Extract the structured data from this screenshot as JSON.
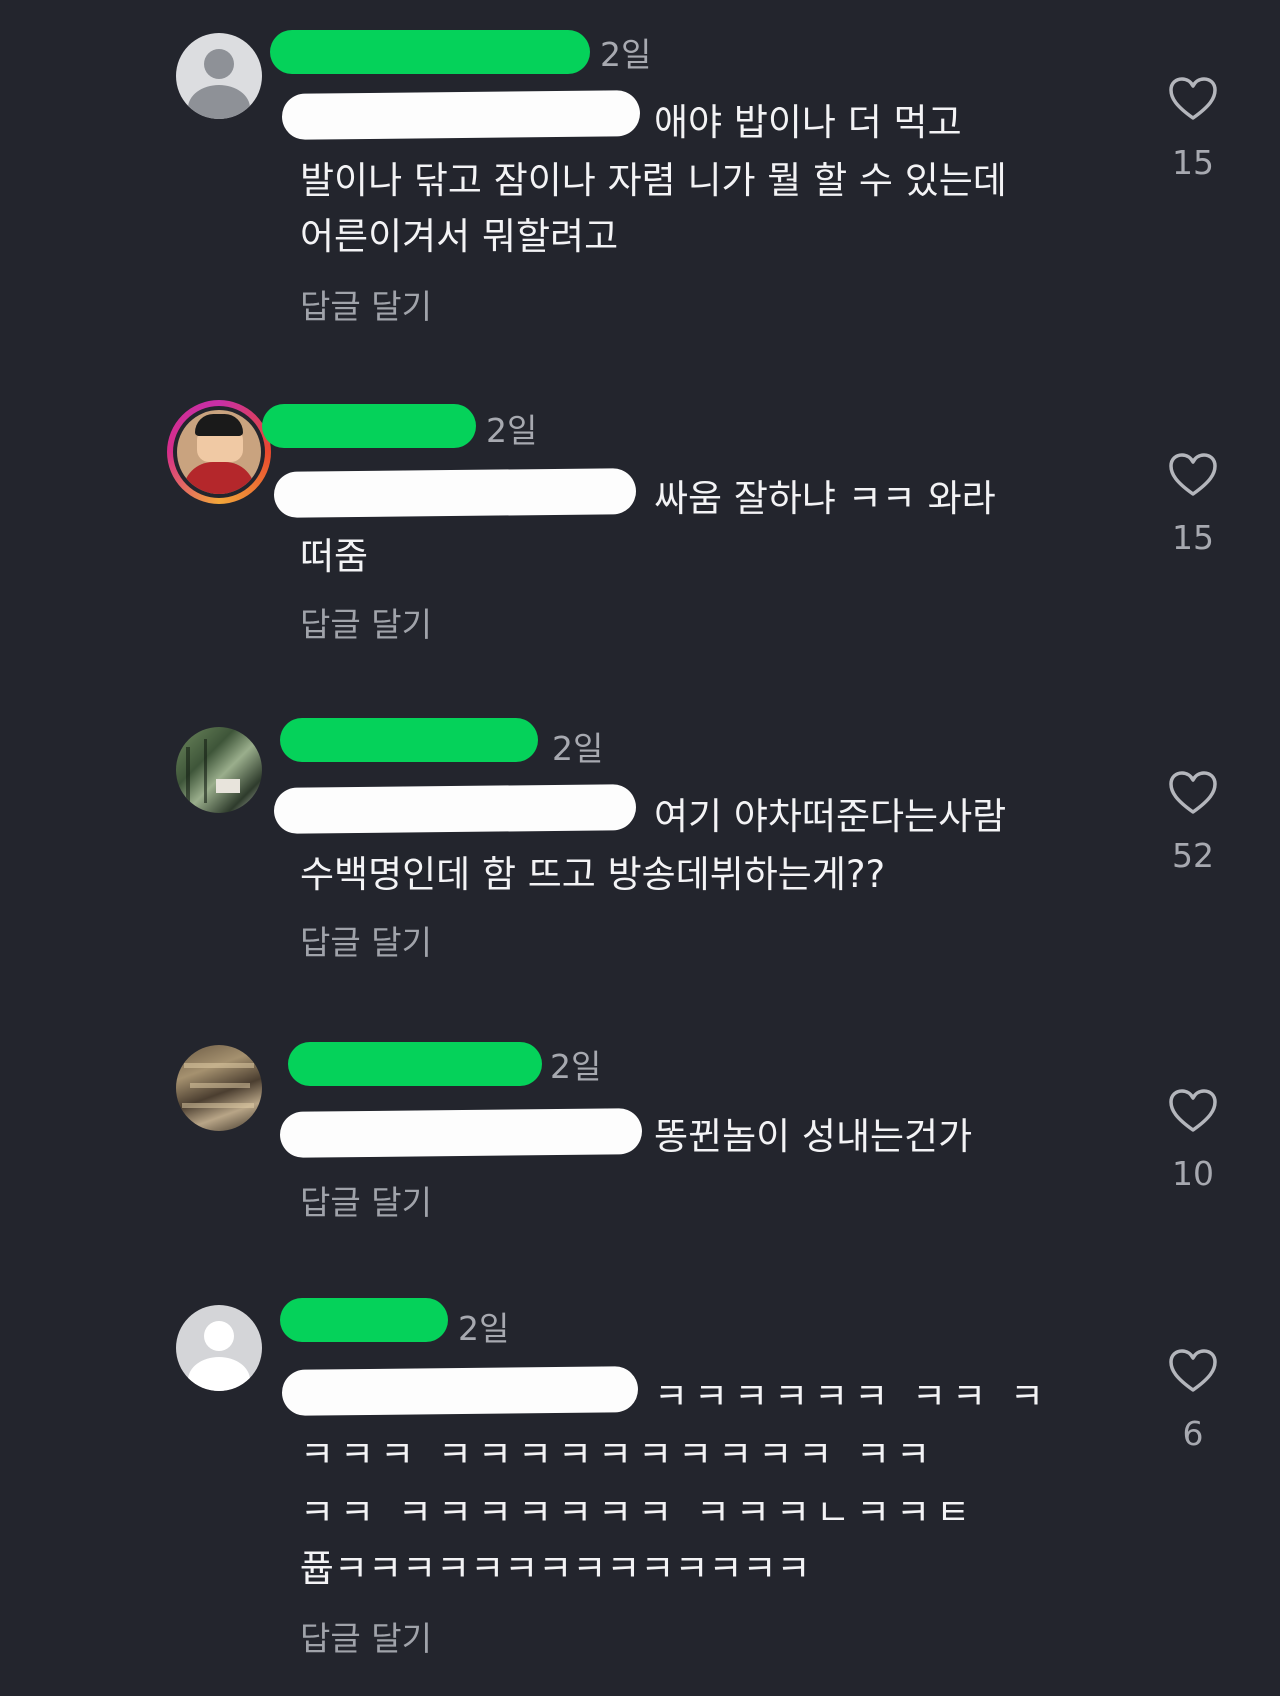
{
  "comments": [
    {
      "time": "2일",
      "lines": [
        "애야 밥이나 더 먹고",
        "발이나 닦고 잠이나 자렴  니가 뭘 할 수 있는데",
        "어른이겨서 뭐할려고"
      ],
      "reply_label": "답글 달기",
      "likes": "15"
    },
    {
      "time": "2일",
      "lines": [
        "싸움 잘하냐 ㅋㅋ 와라",
        "떠줌"
      ],
      "reply_label": "답글 달기",
      "likes": "15"
    },
    {
      "time": "2일",
      "lines": [
        "여기 야차떠준다는사람",
        "수백명인데 함 뜨고 방송데뷔하는게??"
      ],
      "reply_label": "답글 달기",
      "likes": "52"
    },
    {
      "time": "2일",
      "lines": [
        "똥뀐놈이 성내는건가"
      ],
      "reply_label": "답글 달기",
      "likes": "10"
    },
    {
      "time": "2일",
      "lines": [
        "ㅋㅋㅋㅋㅋㅋ ㅋㅋ ㅋ",
        "ㅋㅋㅋ ㅋㅋㅋㅋㅋㅋㅋㅋㅋㅋ ㅋㅋ",
        "ㅋㅋ ㅋㅋㅋㅋㅋㅋㅋ ㅋㅋㅋㄴㅋㅋㅌ",
        "퓹ㅋㅋㅋㅋㅋㅋㅋㅋㅋㅋㅋㅋㅋㅋ"
      ],
      "reply_label": "답글 달기",
      "likes": "6"
    }
  ],
  "colors": {
    "background": "#23252d",
    "redaction_name": "#05d25a",
    "redaction_mention": "#fdfdfd"
  },
  "icons": {
    "like": "heart-outline-icon",
    "avatar_default": "default-avatar-icon"
  }
}
